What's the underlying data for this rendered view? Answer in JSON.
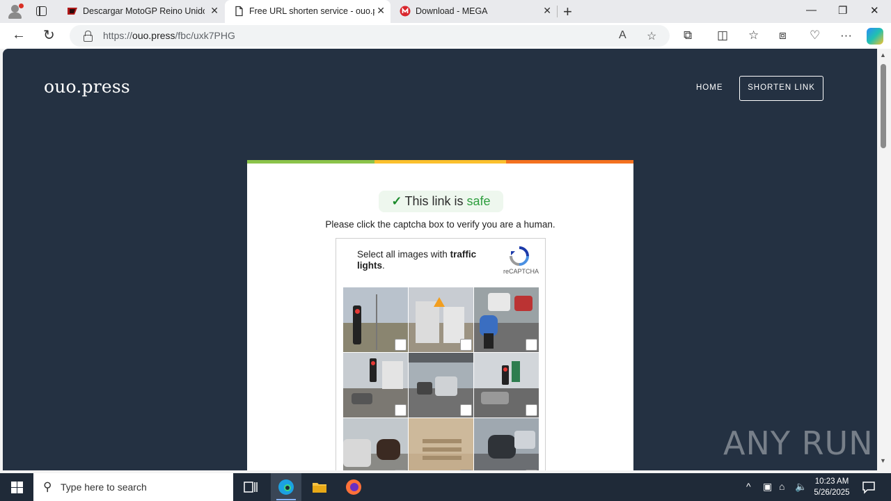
{
  "browser": {
    "tabs": [
      {
        "title": "Descargar MotoGP Reino Unido (",
        "active": false
      },
      {
        "title": "Free URL shorten service - ouo.pr",
        "active": true
      },
      {
        "title": "Download - MEGA",
        "active": false
      }
    ],
    "url_host": "ouo.press",
    "url_prefix": "https://",
    "url_path": "/fbc/uxk7PHG"
  },
  "page": {
    "brand": "ouo.press",
    "nav": {
      "home": "HOME",
      "shorten": "SHORTEN LINK"
    },
    "safe_prefix": "This link is",
    "safe_word": "safe",
    "instruction": "Please click the captcha box to verify you are a human.",
    "captcha": {
      "prompt_prefix": "Select all images with",
      "prompt_bold": "traffic lights",
      "prompt_suffix": ".",
      "logo_text": "reCAPTCHA"
    },
    "watermark": "ANY RUN"
  },
  "taskbar": {
    "search_placeholder": "Type here to search",
    "time": "10:23 AM",
    "date": "5/26/2025"
  },
  "colors": {
    "page_bg": "#243142",
    "bar_green": "#8bc34a",
    "bar_yellow": "#fbc02d",
    "bar_orange": "#f4711f"
  }
}
